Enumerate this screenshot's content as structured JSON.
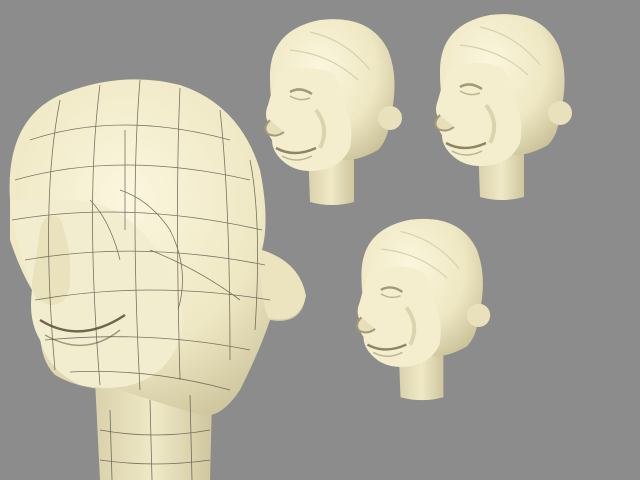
{
  "scene": {
    "background": "#8c8c8c",
    "skin_color": "#efe8c4",
    "skin_shade": "#d7cfa6",
    "skin_dark": "#a49a78",
    "wire_color": "#4d4a3e",
    "views": [
      {
        "id": "large-wireframe",
        "style": "wireframe"
      },
      {
        "id": "small-1",
        "style": "smooth"
      },
      {
        "id": "small-2",
        "style": "smooth"
      },
      {
        "id": "small-3",
        "style": "smooth"
      }
    ]
  }
}
